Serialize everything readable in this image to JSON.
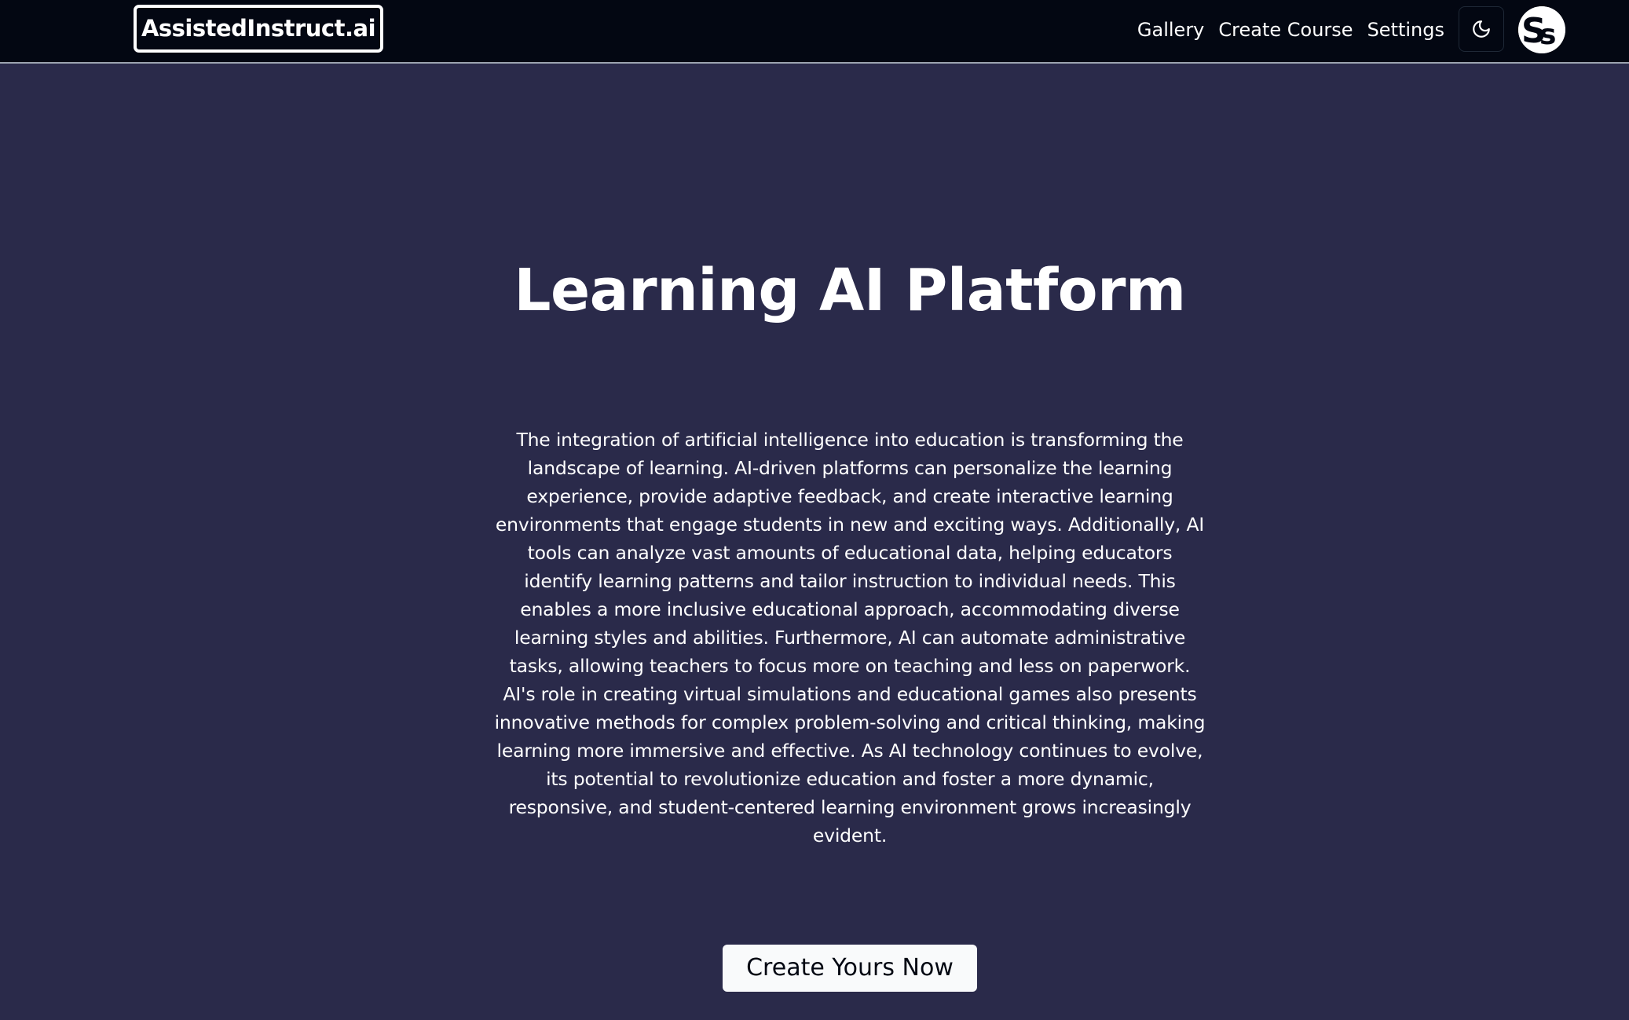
{
  "header": {
    "logo_text": "AssistedInstruct.ai",
    "nav": [
      {
        "label": "Gallery"
      },
      {
        "label": "Create Course"
      },
      {
        "label": "Settings"
      }
    ],
    "theme_toggle_icon": "moon-icon",
    "avatar_text": "S"
  },
  "hero": {
    "title": "Learning AI Platform",
    "body": "The integration of artificial intelligence into education is transforming the landscape of learning. AI-driven platforms can personalize the learning experience, provide adaptive feedback, and create interactive learning environments that engage students in new and exciting ways. Additionally, AI tools can analyze vast amounts of educational data, helping educators identify learning patterns and tailor instruction to individual needs. This enables a more inclusive educational approach, accommodating diverse learning styles and abilities. Furthermore, AI can automate administrative tasks, allowing teachers to focus more on teaching and less on paperwork. AI's role in creating virtual simulations and educational games also presents innovative methods for complex problem-solving and critical thinking, making learning more immersive and effective. As AI technology continues to evolve, its potential to revolutionize education and foster a more dynamic, responsive, and student-centered learning environment grows increasingly evident.",
    "cta_label": "Create Yours Now"
  },
  "colors": {
    "background": "#2a2a4a",
    "navbar": "#030712",
    "text": "#ffffff",
    "button_bg": "#f9fafb",
    "button_text": "#030712"
  }
}
